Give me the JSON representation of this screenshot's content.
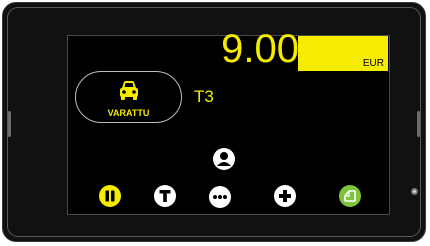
{
  "meter": {
    "fare": "9.00",
    "currency": "EUR",
    "tariff": "T3",
    "status_label": "VARATTU"
  },
  "icons": {
    "status": "car-icon",
    "passenger": "person-icon",
    "pause": "pause-icon",
    "tariff_button": "t-icon",
    "more": "more-icon",
    "add": "plus-icon",
    "receipt": "receipt-icon"
  },
  "colors": {
    "accent_yellow": "#f5ec00",
    "receipt_green": "#7cc43d",
    "screen_background": "#000000"
  }
}
